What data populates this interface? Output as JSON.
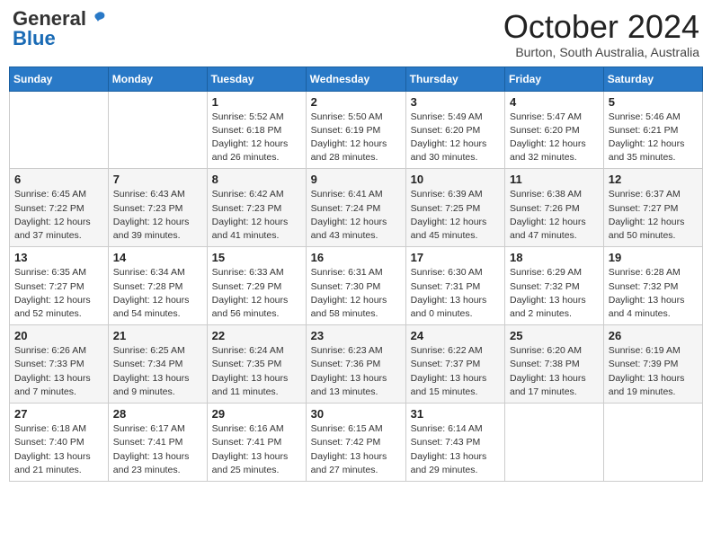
{
  "header": {
    "logo_general": "General",
    "logo_blue": "Blue",
    "month": "October 2024",
    "location": "Burton, South Australia, Australia"
  },
  "weekdays": [
    "Sunday",
    "Monday",
    "Tuesday",
    "Wednesday",
    "Thursday",
    "Friday",
    "Saturday"
  ],
  "weeks": [
    [
      null,
      null,
      {
        "day": "1",
        "sunrise": "5:52 AM",
        "sunset": "6:18 PM",
        "daylight": "12 hours and 26 minutes."
      },
      {
        "day": "2",
        "sunrise": "5:50 AM",
        "sunset": "6:19 PM",
        "daylight": "12 hours and 28 minutes."
      },
      {
        "day": "3",
        "sunrise": "5:49 AM",
        "sunset": "6:20 PM",
        "daylight": "12 hours and 30 minutes."
      },
      {
        "day": "4",
        "sunrise": "5:47 AM",
        "sunset": "6:20 PM",
        "daylight": "12 hours and 32 minutes."
      },
      {
        "day": "5",
        "sunrise": "5:46 AM",
        "sunset": "6:21 PM",
        "daylight": "12 hours and 35 minutes."
      }
    ],
    [
      {
        "day": "6",
        "sunrise": "6:45 AM",
        "sunset": "7:22 PM",
        "daylight": "12 hours and 37 minutes."
      },
      {
        "day": "7",
        "sunrise": "6:43 AM",
        "sunset": "7:23 PM",
        "daylight": "12 hours and 39 minutes."
      },
      {
        "day": "8",
        "sunrise": "6:42 AM",
        "sunset": "7:23 PM",
        "daylight": "12 hours and 41 minutes."
      },
      {
        "day": "9",
        "sunrise": "6:41 AM",
        "sunset": "7:24 PM",
        "daylight": "12 hours and 43 minutes."
      },
      {
        "day": "10",
        "sunrise": "6:39 AM",
        "sunset": "7:25 PM",
        "daylight": "12 hours and 45 minutes."
      },
      {
        "day": "11",
        "sunrise": "6:38 AM",
        "sunset": "7:26 PM",
        "daylight": "12 hours and 47 minutes."
      },
      {
        "day": "12",
        "sunrise": "6:37 AM",
        "sunset": "7:27 PM",
        "daylight": "12 hours and 50 minutes."
      }
    ],
    [
      {
        "day": "13",
        "sunrise": "6:35 AM",
        "sunset": "7:27 PM",
        "daylight": "12 hours and 52 minutes."
      },
      {
        "day": "14",
        "sunrise": "6:34 AM",
        "sunset": "7:28 PM",
        "daylight": "12 hours and 54 minutes."
      },
      {
        "day": "15",
        "sunrise": "6:33 AM",
        "sunset": "7:29 PM",
        "daylight": "12 hours and 56 minutes."
      },
      {
        "day": "16",
        "sunrise": "6:31 AM",
        "sunset": "7:30 PM",
        "daylight": "12 hours and 58 minutes."
      },
      {
        "day": "17",
        "sunrise": "6:30 AM",
        "sunset": "7:31 PM",
        "daylight": "13 hours and 0 minutes."
      },
      {
        "day": "18",
        "sunrise": "6:29 AM",
        "sunset": "7:32 PM",
        "daylight": "13 hours and 2 minutes."
      },
      {
        "day": "19",
        "sunrise": "6:28 AM",
        "sunset": "7:32 PM",
        "daylight": "13 hours and 4 minutes."
      }
    ],
    [
      {
        "day": "20",
        "sunrise": "6:26 AM",
        "sunset": "7:33 PM",
        "daylight": "13 hours and 7 minutes."
      },
      {
        "day": "21",
        "sunrise": "6:25 AM",
        "sunset": "7:34 PM",
        "daylight": "13 hours and 9 minutes."
      },
      {
        "day": "22",
        "sunrise": "6:24 AM",
        "sunset": "7:35 PM",
        "daylight": "13 hours and 11 minutes."
      },
      {
        "day": "23",
        "sunrise": "6:23 AM",
        "sunset": "7:36 PM",
        "daylight": "13 hours and 13 minutes."
      },
      {
        "day": "24",
        "sunrise": "6:22 AM",
        "sunset": "7:37 PM",
        "daylight": "13 hours and 15 minutes."
      },
      {
        "day": "25",
        "sunrise": "6:20 AM",
        "sunset": "7:38 PM",
        "daylight": "13 hours and 17 minutes."
      },
      {
        "day": "26",
        "sunrise": "6:19 AM",
        "sunset": "7:39 PM",
        "daylight": "13 hours and 19 minutes."
      }
    ],
    [
      {
        "day": "27",
        "sunrise": "6:18 AM",
        "sunset": "7:40 PM",
        "daylight": "13 hours and 21 minutes."
      },
      {
        "day": "28",
        "sunrise": "6:17 AM",
        "sunset": "7:41 PM",
        "daylight": "13 hours and 23 minutes."
      },
      {
        "day": "29",
        "sunrise": "6:16 AM",
        "sunset": "7:41 PM",
        "daylight": "13 hours and 25 minutes."
      },
      {
        "day": "30",
        "sunrise": "6:15 AM",
        "sunset": "7:42 PM",
        "daylight": "13 hours and 27 minutes."
      },
      {
        "day": "31",
        "sunrise": "6:14 AM",
        "sunset": "7:43 PM",
        "daylight": "13 hours and 29 minutes."
      },
      null,
      null
    ]
  ],
  "labels": {
    "sunrise_prefix": "Sunrise: ",
    "sunset_prefix": "Sunset: ",
    "daylight_prefix": "Daylight: "
  }
}
